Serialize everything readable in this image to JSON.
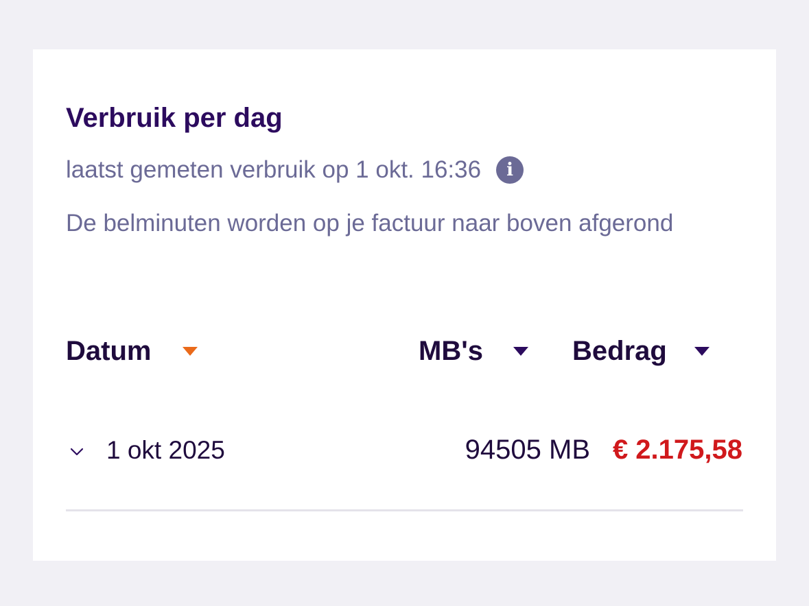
{
  "card": {
    "title": "Verbruik per dag",
    "subtitle": "laatst gemeten verbruik op 1 okt. 16:36",
    "info_icon": "info-icon",
    "note": "De belminuten worden op je factuur naar boven afgerond"
  },
  "table": {
    "columns": [
      {
        "label": "Datum",
        "sort_active": true
      },
      {
        "label": "MB's",
        "sort_active": false
      },
      {
        "label": "Bedrag",
        "sort_active": false
      }
    ],
    "rows": [
      {
        "date": "1 okt 2025",
        "mb": "94505 MB",
        "amount": "€ 2.175,58"
      }
    ]
  },
  "colors": {
    "title": "#2c0b5e",
    "muted": "#6b6a96",
    "sort_active": "#ea6a1a",
    "amount": "#d0191c",
    "background": "#f1f0f5"
  }
}
